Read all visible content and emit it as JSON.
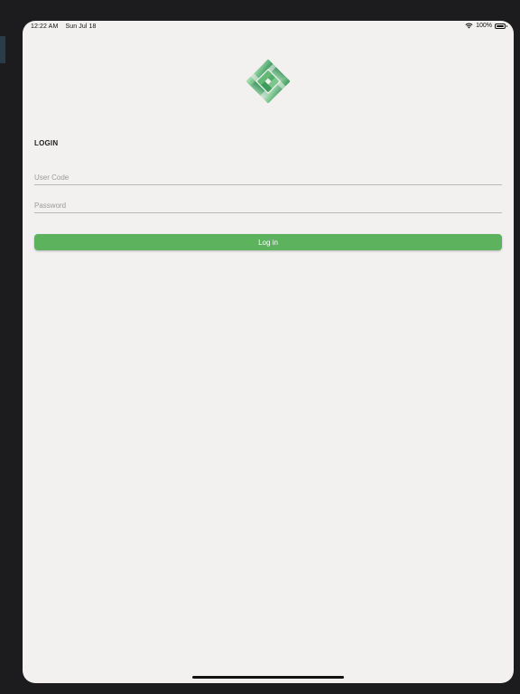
{
  "status_bar": {
    "time": "12:22 AM",
    "date": "Sun Jul 18",
    "battery": "100%",
    "battery_level": 1.0,
    "icons": [
      "wifi-icon",
      "battery-icon"
    ]
  },
  "logo": {
    "icon": "woven-square-logo-icon",
    "colors": [
      "#2e8b57",
      "#5cb85c",
      "#9fd8a8"
    ]
  },
  "login": {
    "heading": "LOGIN",
    "user_code_placeholder": "User Code",
    "user_code_value": "",
    "password_placeholder": "Password",
    "password_value": "",
    "button_label": "Log in"
  },
  "colors": {
    "accent": "#5cb25d",
    "background": "#f2f1f0",
    "placeholder": "#9a9a9a"
  }
}
